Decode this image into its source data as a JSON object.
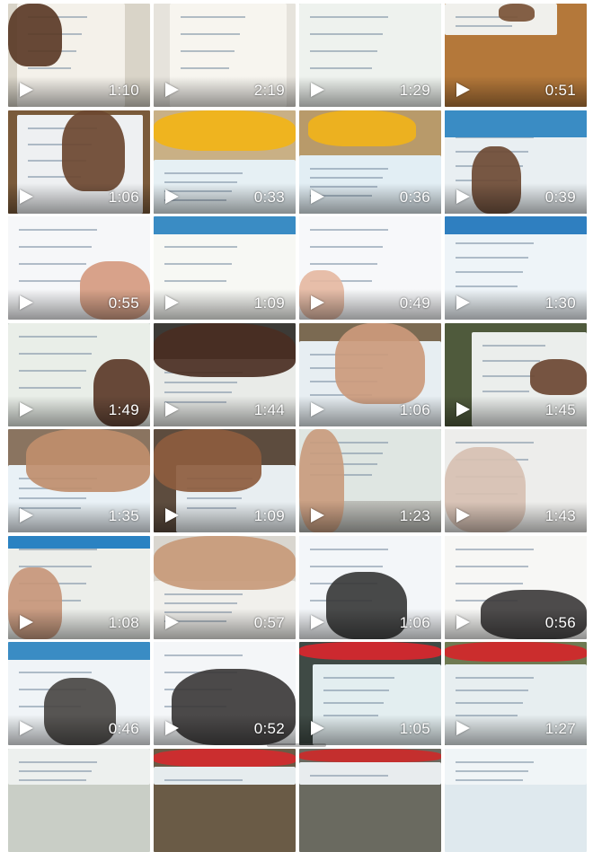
{
  "gallery": {
    "videos": [
      {
        "duration": "1:10",
        "thumb": "textbook-hand-dark"
      },
      {
        "duration": "2:19",
        "thumb": "textbook-page-text"
      },
      {
        "duration": "1:29",
        "thumb": "textbook-pictures"
      },
      {
        "duration": "0:51",
        "thumb": "finger-on-page-mat"
      },
      {
        "duration": "1:06",
        "thumb": "hand-on-textbook"
      },
      {
        "duration": "0:33",
        "thumb": "child-yellow-reading"
      },
      {
        "duration": "0:36",
        "thumb": "child-yellow-pointing"
      },
      {
        "duration": "0:39",
        "thumb": "finger-blue-header"
      },
      {
        "duration": "0:55",
        "thumb": "hand-word-columns"
      },
      {
        "duration": "1:09",
        "thumb": "page-tree-pictures"
      },
      {
        "duration": "0:49",
        "thumb": "word-table"
      },
      {
        "duration": "1:30",
        "thumb": "pictures-row"
      },
      {
        "duration": "1:49",
        "thumb": "hand-pictures-left"
      },
      {
        "duration": "1:44",
        "thumb": "dark-hand-book"
      },
      {
        "duration": "1:06",
        "thumb": "child-hands-book"
      },
      {
        "duration": "1:45",
        "thumb": "hand-right-book"
      },
      {
        "duration": "1:35",
        "thumb": "hands-on-floor-book"
      },
      {
        "duration": "1:09",
        "thumb": "hand-open-book"
      },
      {
        "duration": "1:23",
        "thumb": "blurred-page-face"
      },
      {
        "duration": "1:43",
        "thumb": "blurred-white-page"
      },
      {
        "duration": "1:08",
        "thumb": "hand-page-corner"
      },
      {
        "duration": "0:57",
        "thumb": "hand-blank-page"
      },
      {
        "duration": "1:06",
        "thumb": "finger-word-list"
      },
      {
        "duration": "0:56",
        "thumb": "page-figures"
      },
      {
        "duration": "0:46",
        "thumb": "shadow-word-table"
      },
      {
        "duration": "0:52",
        "thumb": "shadow-words"
      },
      {
        "duration": "1:05",
        "thumb": "child-red-pointing"
      },
      {
        "duration": "1:27",
        "thumb": "child-red-book"
      },
      {
        "duration": "",
        "thumb": "partial-blue-page"
      },
      {
        "duration": "",
        "thumb": "partial-red-shirt"
      },
      {
        "duration": "",
        "thumb": "partial-red-book"
      },
      {
        "duration": "",
        "thumb": "partial-text-page"
      }
    ]
  },
  "icons": {
    "play": "play-icon"
  }
}
